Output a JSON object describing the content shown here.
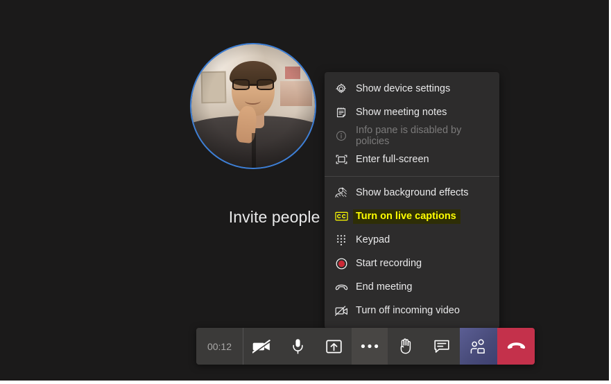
{
  "app": {
    "background_color": "#1b1a1a",
    "stage_message": "Invite people to join y"
  },
  "avatar": {
    "name": "participant-avatar",
    "ring_color": "#3d7fd6"
  },
  "context_menu": {
    "background_color": "#2d2c2c",
    "items": [
      {
        "icon": "gear-icon",
        "label": "Show device settings",
        "state": "normal"
      },
      {
        "icon": "notes-icon",
        "label": "Show meeting notes",
        "state": "normal"
      },
      {
        "icon": "info-icon",
        "label": "Info pane is disabled by policies",
        "state": "disabled"
      },
      {
        "icon": "fullscreen-icon",
        "label": "Enter full-screen",
        "state": "normal"
      },
      {
        "icon": "background-effects-icon",
        "label": "Show background effects",
        "state": "normal"
      },
      {
        "icon": "cc-icon",
        "label": "Turn on live captions",
        "state": "highlighted"
      },
      {
        "icon": "keypad-icon",
        "label": "Keypad",
        "state": "normal"
      },
      {
        "icon": "record-icon",
        "label": "Start recording",
        "state": "normal"
      },
      {
        "icon": "end-meeting-icon",
        "label": "End meeting",
        "state": "normal"
      },
      {
        "icon": "incoming-video-off-icon",
        "label": "Turn off incoming video",
        "state": "normal"
      }
    ],
    "highlight": {
      "text_color": "#ffff00",
      "background_color": "#2e2e06"
    }
  },
  "control_bar": {
    "timer": "00:12",
    "buttons": [
      {
        "icon": "camera-off-icon",
        "name": "camera-toggle-button",
        "state": "normal"
      },
      {
        "icon": "microphone-icon",
        "name": "microphone-toggle-button",
        "state": "normal"
      },
      {
        "icon": "share-screen-icon",
        "name": "share-screen-button",
        "state": "normal"
      },
      {
        "icon": "more-options-icon",
        "name": "more-options-button",
        "state": "active"
      },
      {
        "icon": "raise-hand-icon",
        "name": "raise-hand-button",
        "state": "normal"
      },
      {
        "icon": "chat-icon",
        "name": "chat-button",
        "state": "normal"
      },
      {
        "icon": "people-icon",
        "name": "show-participants-button",
        "state": "people"
      },
      {
        "icon": "hangup-icon",
        "name": "hang-up-button",
        "state": "hangup"
      }
    ],
    "colors": {
      "default": "#3b3a39",
      "active": "#484644",
      "people": "#4a4d7c",
      "hangup": "#c4314b",
      "timer_text": "#a9a8a7"
    }
  }
}
